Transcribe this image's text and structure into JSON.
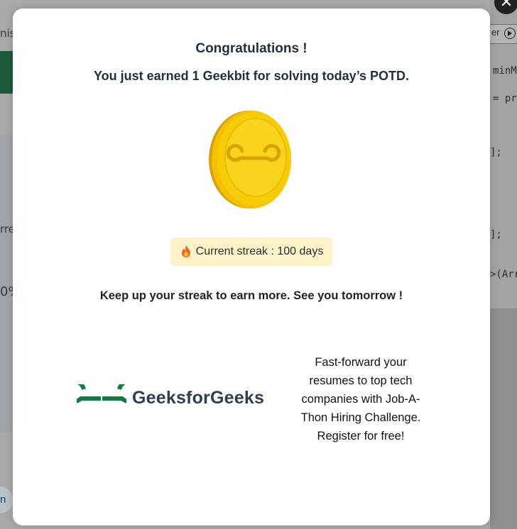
{
  "modal": {
    "title": "Congratulations !",
    "subtitle": "You just earned 1 Geekbit for solving today’s POTD.",
    "streak_label": "Current streak : 100 days",
    "encouragement": "Keep up your streak to earn more. See you tomorrow !",
    "brand_name": "GeeksforGeeks",
    "promo_text": "Fast-forward your resumes to top tech companies with Job-A-Thon Hiring Challenge. Register for free!",
    "close_label": "✕"
  },
  "background": {
    "left_snippets": [
      "niss",
      "rre",
      "0%"
    ],
    "run_label": "er",
    "code_lines": [
      "minM",
      "= pr",
      "];",
      "];",
      ">(Arr"
    ],
    "chip_text": "n"
  },
  "colors": {
    "brand_green": "#0f7a42",
    "coin_gold": "#f5c400",
    "streak_bg": "#fdf3c9",
    "heading": "#1f2f3d"
  },
  "icons": {
    "coin": "geekbit-coin-icon",
    "flame": "flame-icon",
    "logo": "gfg-logo-icon",
    "close": "close-icon",
    "run": "play-circle-icon"
  }
}
